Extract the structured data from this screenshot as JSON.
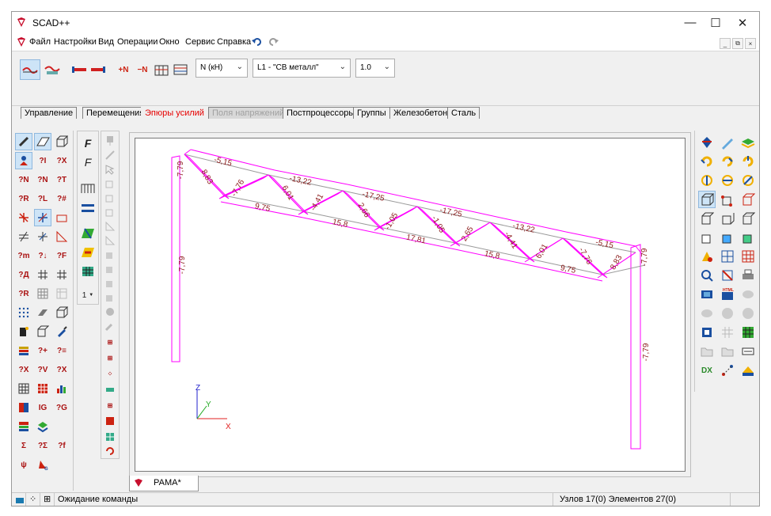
{
  "window": {
    "title": "SCAD++"
  },
  "menu": [
    "Файл",
    "Настройки",
    "Вид",
    "Операции",
    "Окно",
    "Сервис",
    "Справка"
  ],
  "ribbon": {
    "force_combo": "N (кН)",
    "load_combo": "L1 - \"СВ металл\"",
    "scale_combo": "1.0"
  },
  "tabs": [
    {
      "label": "Управление"
    },
    {
      "label": "Перемещения..."
    },
    {
      "label": "Эпюры усилий"
    },
    {
      "label": "Поля напряжений"
    },
    {
      "label": "Постпроцессоры"
    },
    {
      "label": "Группы"
    },
    {
      "label": "Железобетон"
    },
    {
      "label": "Сталь"
    }
  ],
  "toolcol2_count": "1",
  "diagram_labels": {
    "top": [
      "-5,15",
      "-13,22",
      "-17,25",
      "-17,25",
      "-13,22",
      "-5,15"
    ],
    "bottom": [
      "9,75",
      "15,8",
      "17,81",
      "15,8",
      "9,75"
    ],
    "diag": [
      "8,83",
      "-7,76",
      "6,01",
      "-4,41",
      "2,66",
      "-1,05",
      "-1,05",
      "2,65",
      "-4,41",
      "6,01",
      "-7,76",
      "8,83"
    ],
    "col": [
      "-7,79",
      "-7,79",
      "-7,79",
      "-7,79"
    ]
  },
  "axes": {
    "x": "X",
    "y": "Y",
    "z": "Z"
  },
  "doc_tab": "РАМА*",
  "status": {
    "message": "Ожидание команды",
    "counts": "Узлов 17(0) Элементов 27(0)"
  }
}
